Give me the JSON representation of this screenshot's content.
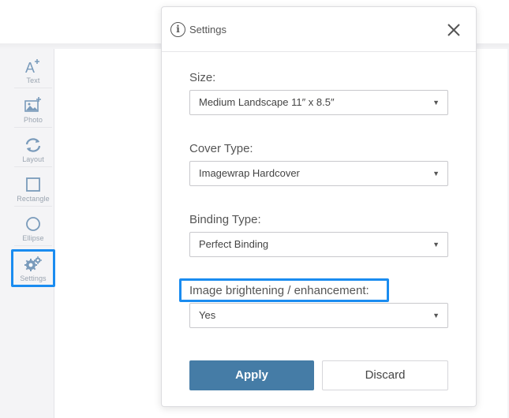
{
  "toolbar": {
    "items": [
      {
        "label": "Text",
        "icon": "text-add-icon"
      },
      {
        "label": "Photo",
        "icon": "photo-add-icon"
      },
      {
        "label": "Layout",
        "icon": "layout-refresh-icon"
      },
      {
        "label": "Rectangle",
        "icon": "rectangle-icon"
      },
      {
        "label": "Ellipse",
        "icon": "ellipse-icon"
      },
      {
        "label": "Settings",
        "icon": "gears-icon"
      }
    ]
  },
  "dialog": {
    "title": "Settings",
    "fields": {
      "size": {
        "label": "Size:",
        "value": "Medium Landscape 11″ x 8.5″"
      },
      "cover": {
        "label": "Cover Type:",
        "value": "Imagewrap Hardcover"
      },
      "binding": {
        "label": "Binding Type:",
        "value": "Perfect Binding"
      },
      "enhance": {
        "label": "Image brightening / enhancement:",
        "value": "Yes"
      }
    },
    "apply_label": "Apply",
    "discard_label": "Discard"
  },
  "colors": {
    "accent_highlight": "#1a8cf0",
    "apply_button": "#457ca6",
    "tool_icon": "#7a9bbb"
  }
}
